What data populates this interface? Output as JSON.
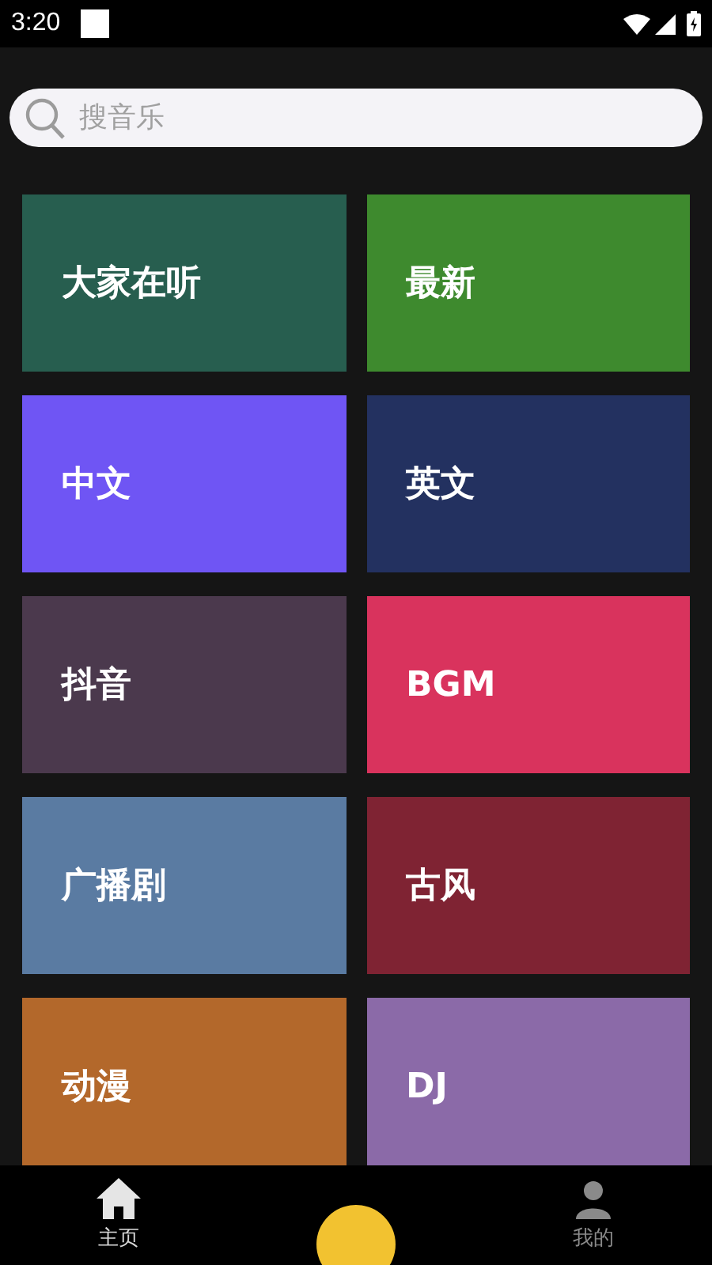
{
  "status_bar": {
    "time": "3:20"
  },
  "search": {
    "placeholder": "搜音乐"
  },
  "categories": [
    {
      "label": "大家在听",
      "color": "#275e4f"
    },
    {
      "label": "最新",
      "color": "#3e8a2e"
    },
    {
      "label": "中文",
      "color": "#6f55f4"
    },
    {
      "label": "英文",
      "color": "#233160"
    },
    {
      "label": "抖音",
      "color": "#4b394d"
    },
    {
      "label": "BGM",
      "color": "#d9335d"
    },
    {
      "label": "广播剧",
      "color": "#5a7ba2"
    },
    {
      "label": "古风",
      "color": "#7f2333"
    },
    {
      "label": "动漫",
      "color": "#b3682b"
    },
    {
      "label": "DJ",
      "color": "#8b6aa8"
    }
  ],
  "bottom_nav": [
    {
      "kind": "home",
      "label": "主页",
      "selected": true
    },
    {
      "kind": "center"
    },
    {
      "kind": "profile",
      "label": "我的",
      "selected": false
    }
  ]
}
